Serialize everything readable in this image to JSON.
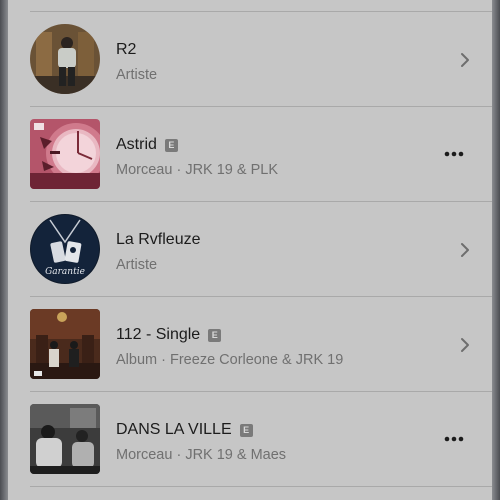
{
  "results": [
    {
      "title": "R2",
      "explicit": false,
      "type": "Artiste",
      "artists": "",
      "action": "chevron-right-icon",
      "art_shape": "round"
    },
    {
      "title": "Astrid",
      "explicit": true,
      "type": "Morceau",
      "artists": "JRK 19 & PLK",
      "action": "more-icon",
      "art_shape": "square"
    },
    {
      "title": "La Rvfleuze",
      "explicit": false,
      "type": "Artiste",
      "artists": "",
      "action": "chevron-right-icon",
      "art_shape": "round"
    },
    {
      "title": "112 - Single",
      "explicit": true,
      "type": "Album",
      "artists": "Freeze Corleone & JRK 19",
      "action": "chevron-right-icon",
      "art_shape": "square"
    },
    {
      "title": "DANS LA VILLE",
      "explicit": true,
      "type": "Morceau",
      "artists": "JRK 19 & Maes",
      "action": "more-icon",
      "art_shape": "square"
    }
  ],
  "explicit_label": "E",
  "separator": " · ",
  "art_lettering": {
    "astrid": "ASTRID",
    "rvfleuze": "Garantie"
  }
}
